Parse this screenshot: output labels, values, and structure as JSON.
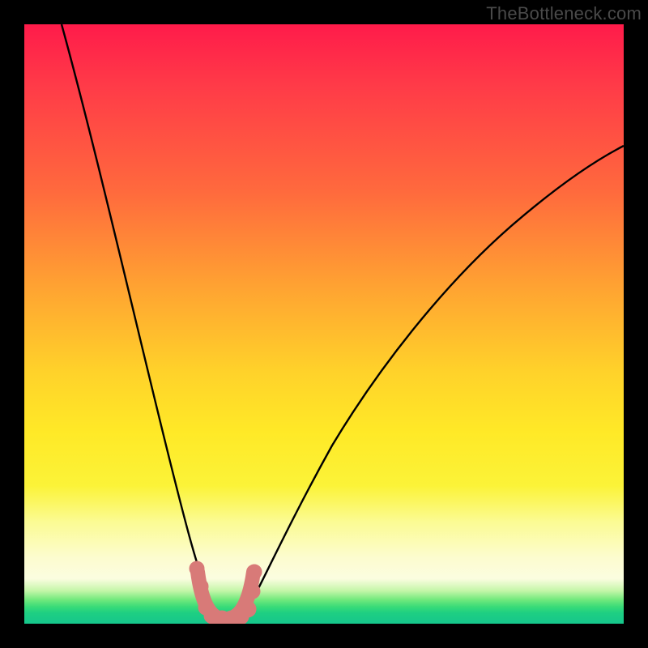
{
  "watermark": "TheBottleneck.com",
  "chart_data": {
    "type": "line",
    "title": "",
    "xlabel": "",
    "ylabel": "",
    "xlim": [
      0,
      100
    ],
    "ylim": [
      0,
      100
    ],
    "background_gradient": {
      "top_color": "#ff1b4a",
      "mid_color": "#ffe927",
      "bottom_color": "#16c68c",
      "meaning": "red=high bottleneck, green=no bottleneck"
    },
    "series": [
      {
        "name": "bottleneck-curve",
        "note": "V-shaped curve; y≈0 indicates optimal match, rises steeply on both sides",
        "x": [
          6,
          10,
          15,
          20,
          24,
          27,
          29,
          31,
          33,
          35,
          37,
          40,
          45,
          50,
          55,
          60,
          70,
          80,
          90,
          100
        ],
        "y": [
          100,
          80,
          58,
          38,
          22,
          12,
          5,
          1,
          0,
          0,
          1,
          5,
          15,
          25,
          33,
          40,
          52,
          62,
          70,
          77
        ]
      },
      {
        "name": "highlight-dots",
        "note": "pink marker dots near the trough",
        "color": "#d87a78",
        "x": [
          28.5,
          29.0,
          30.0,
          31.0,
          32.5,
          34.0,
          35.5,
          36.8,
          37.5,
          37.8
        ],
        "y": [
          9.0,
          6.0,
          1.5,
          0.8,
          0.6,
          0.7,
          1.0,
          2.5,
          6.5,
          10.0
        ]
      }
    ],
    "optimal_x_range": [
      31,
      36
    ]
  }
}
